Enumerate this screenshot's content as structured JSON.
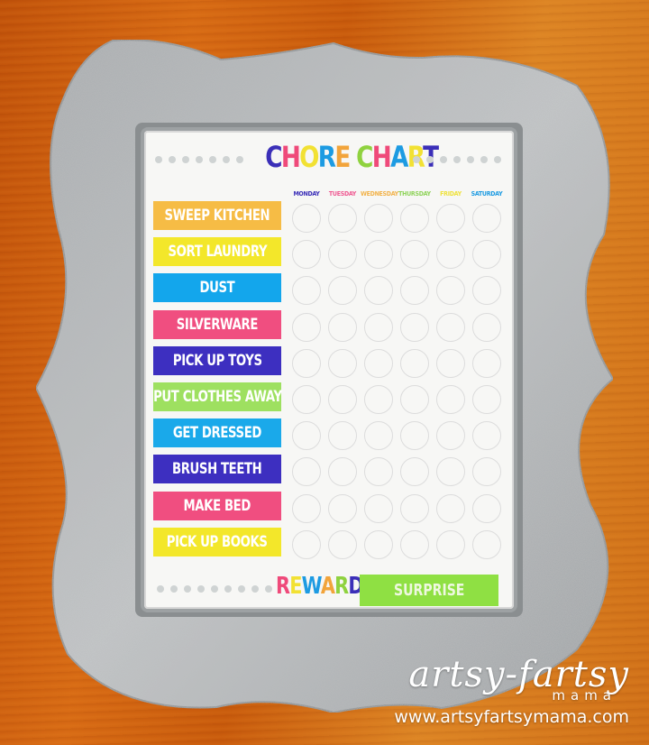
{
  "scene": {
    "description": "Silver glitter scalloped frame holding a printed chore chart on a wooden surface"
  },
  "chart": {
    "title_letters": [
      {
        "ch": "C",
        "color": "#3b2fb8"
      },
      {
        "ch": "H",
        "color": "#ef4a7a"
      },
      {
        "ch": "O",
        "color": "#f2e133"
      },
      {
        "ch": "R",
        "color": "#1d9be2"
      },
      {
        "ch": "E",
        "color": "#f2a43b"
      },
      {
        "ch": " ",
        "color": "#000000"
      },
      {
        "ch": "C",
        "color": "#8fd23f"
      },
      {
        "ch": "H",
        "color": "#ef4a7a"
      },
      {
        "ch": "A",
        "color": "#1d9be2"
      },
      {
        "ch": "R",
        "color": "#f2e133"
      },
      {
        "ch": "T",
        "color": "#3b2fb8"
      }
    ],
    "days": [
      {
        "label": "MONDAY",
        "color": "#3b2fb8"
      },
      {
        "label": "TUESDAY",
        "color": "#ef5a92"
      },
      {
        "label": "WEDNESDAY",
        "color": "#f2b34b"
      },
      {
        "label": "THURSDAY",
        "color": "#8fd35a"
      },
      {
        "label": "FRIDAY",
        "color": "#efe23c"
      },
      {
        "label": "SATURDAY",
        "color": "#1d9be2"
      }
    ],
    "chores": [
      {
        "label": "SWEEP KITCHEN",
        "color": "#f6bc45"
      },
      {
        "label": "SORT LAUNDRY",
        "color": "#f3e72a"
      },
      {
        "label": "DUST",
        "color": "#13a6ec"
      },
      {
        "label": "SILVERWARE",
        "color": "#f04e80"
      },
      {
        "label": "PICK UP TOYS",
        "color": "#3d2fc0"
      },
      {
        "label": "PUT CLOTHES AWAY",
        "color": "#9ee060"
      },
      {
        "label": "GET DRESSED",
        "color": "#1aa9ea"
      },
      {
        "label": "BRUSH TEETH",
        "color": "#3d2fc0"
      },
      {
        "label": "MAKE BED",
        "color": "#f04e80"
      },
      {
        "label": "PICK UP BOOKS",
        "color": "#f3e72a"
      }
    ],
    "reward": {
      "letters": [
        {
          "ch": "R",
          "color": "#ef4a7a"
        },
        {
          "ch": "E",
          "color": "#f2e133"
        },
        {
          "ch": "W",
          "color": "#1d9be2"
        },
        {
          "ch": "A",
          "color": "#f2a43b"
        },
        {
          "ch": "R",
          "color": "#8fd23f"
        },
        {
          "ch": "D",
          "color": "#3b2fb8"
        }
      ],
      "value": "SURPRISE",
      "value_color": "#8fe043"
    }
  },
  "watermark": {
    "brand": "artsy-fartsy",
    "sub": "mama",
    "url": "www.artsyfartsymama.com"
  },
  "colors": {
    "frame": "#b3b7b9",
    "wood": "#cf6514",
    "paper": "#f7f7f5"
  }
}
